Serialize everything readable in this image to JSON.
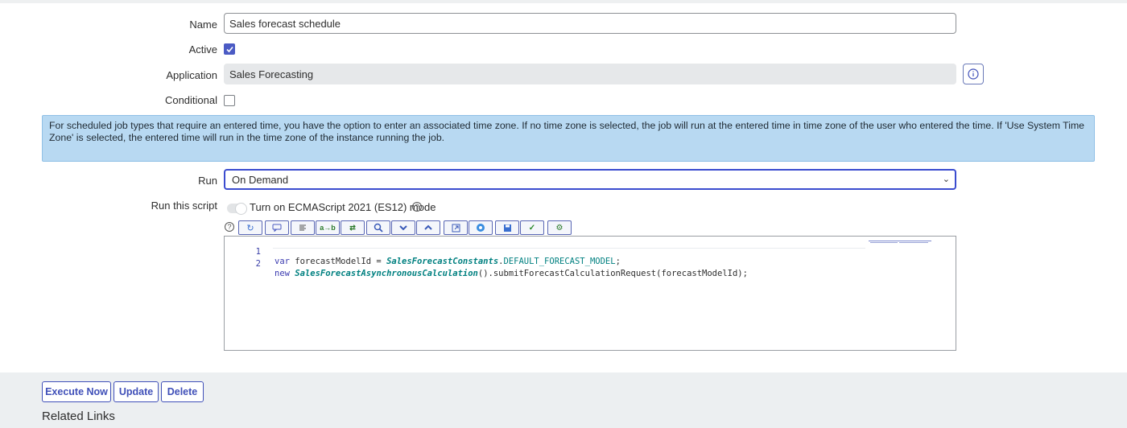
{
  "form": {
    "name_label": "Name",
    "name_value": "Sales forecast schedule",
    "active_label": "Active",
    "active_checked": true,
    "application_label": "Application",
    "application_value": "Sales Forecasting",
    "conditional_label": "Conditional",
    "conditional_checked": false,
    "notice_text": "For scheduled job types that require an entered time, you have the option to enter an associated time zone. If no time zone is selected, the job will run at the entered time in time zone of the user who entered the time. If 'Use System Time Zone' is selected, the entered time will run in the time zone of the instance running the job.",
    "run_label": "Run",
    "run_value": "On Demand",
    "script_label": "Run this script",
    "es_toggle_label": "Turn on ECMAScript 2021 (ES12) mode",
    "es_toggle_on": false
  },
  "editor": {
    "lines": [
      {
        "num": "1",
        "tokens": [
          [
            "kw",
            "var"
          ],
          [
            "p",
            " forecastModelId = "
          ],
          [
            "cls",
            "SalesForecastConstants"
          ],
          [
            "p",
            "."
          ],
          [
            "cst",
            "DEFAULT_FORECAST_MODEL"
          ],
          [
            "p",
            ";"
          ]
        ]
      },
      {
        "num": "2",
        "tokens": [
          [
            "kw",
            "new"
          ],
          [
            "p",
            " "
          ],
          [
            "cls",
            "SalesForecastAsynchronousCalculation"
          ],
          [
            "p",
            "()."
          ],
          [
            "p",
            "submitForecastCalculationRequest("
          ],
          [
            "p",
            "forecastModelId);"
          ]
        ]
      }
    ],
    "toolbar_icons": [
      "help-icon",
      "toggle-syntax-icon",
      "comment-icon",
      "format-code-icon",
      "replace-icon",
      "replace-all-icon",
      "search-icon",
      "next-icon",
      "previous-icon",
      "fullscreen-icon",
      "script-debugger-icon",
      "save-icon",
      "check-syntax-icon",
      "script-tree-icon"
    ]
  },
  "footer": {
    "execute_label": "Execute Now",
    "update_label": "Update",
    "delete_label": "Delete",
    "related_links": "Related Links"
  },
  "colors": {
    "accent": "#3f4fb8",
    "notice_bg": "#b8d9f2",
    "readonly_bg": "#e6e8ea"
  }
}
